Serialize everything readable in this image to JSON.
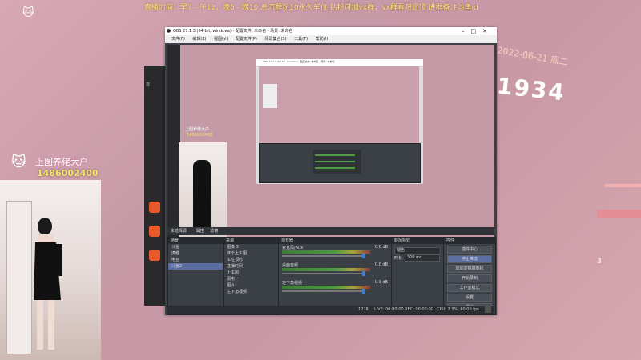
{
  "banner": "直播时间：早7 - 午12，晚5 - 晚10 总流群粉10永久车位 钻粉可加vx群，vx群看吧置顶 进群备注斗鱼id",
  "streamer": {
    "nick": "上图养佬大户",
    "uid": "1486002400"
  },
  "decor": {
    "date": "2022-06-21 周二",
    "bignum": "1934",
    "num3": "3"
  },
  "obs": {
    "title": "OBS 27.1.3 (64-bit, windows) - 配置文件: 未命名 - 场景: 未命名",
    "menu": [
      "文件(F)",
      "编辑(E)",
      "视图(V)",
      "配置文件(P)",
      "场景集合(S)",
      "工具(T)",
      "帮助(H)"
    ],
    "preview": {
      "nick": "上图养佬大户",
      "uid": "1486002400"
    },
    "scenes": {
      "header": "场景",
      "items": [
        "斗鱼",
        "虎趣",
        "电台",
        "斗鱼2"
      ],
      "selected": 3
    },
    "sources_toolbar": {
      "filter_label": "未选择源",
      "properties": "属性",
      "filters": "滤镜"
    },
    "sources": {
      "header": "来源",
      "items": [
        "图像 3",
        "抹乐上车图",
        "车位顶时",
        "直播时间",
        "上车图",
        "阐电一",
        "图片",
        "左下角视频"
      ]
    },
    "mixer": {
      "header": "混音器",
      "tracks": [
        {
          "name": "麦克风/Aux",
          "db": "0.0 dB"
        },
        {
          "name": "桌面音频",
          "db": "0.0 dB"
        },
        {
          "name": "左下角视频",
          "db": "0.0 dB"
        }
      ]
    },
    "transitions": {
      "header": "转场特效",
      "type": "褪色",
      "duration_label": "时长",
      "duration": "300 ms"
    },
    "controls": {
      "header": "控件",
      "buttons": [
        "插件中心",
        "停止推流",
        "启动虚拟摄像机",
        "开始录制",
        "工作室模式",
        "设置",
        "退出"
      ],
      "selected": 1
    },
    "status": {
      "dropped": "1278",
      "live": "LIVE: 00:00:00",
      "rec": "REC: 00:00:00",
      "cpu": "CPU: 2.3%, 60.00 fps"
    },
    "footer_icons": "+ − ∧ ∨"
  },
  "colors": {
    "accent": "#5a6ea2",
    "banner": "#f5e66b",
    "meter": "#4e9a43"
  }
}
